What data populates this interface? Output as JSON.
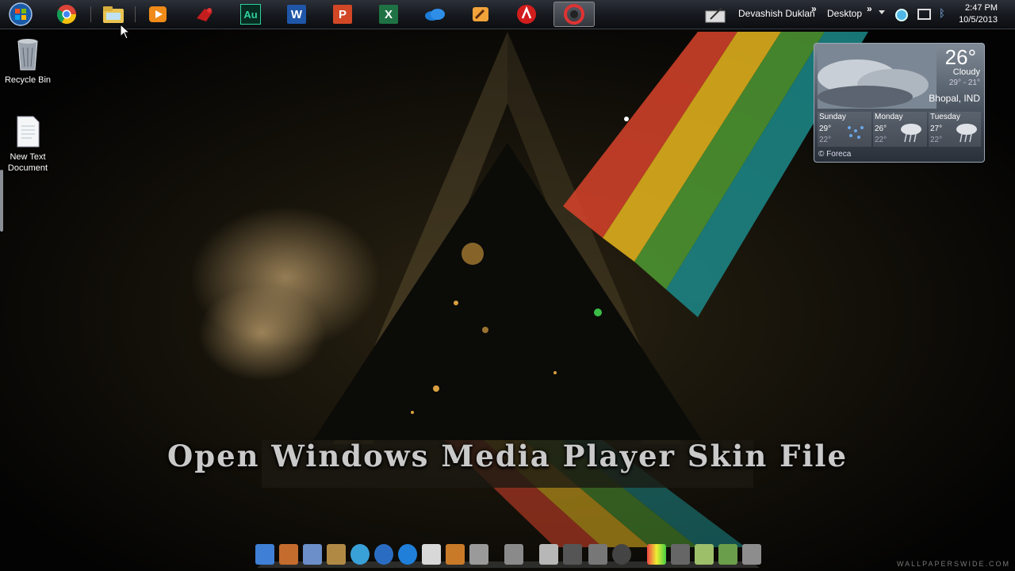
{
  "taskbar": {
    "start_button": "start-orb-icon",
    "pinned": [
      "chrome-icon",
      "windows-explorer-icon",
      "media-player-icon",
      "app-icon",
      "audition-icon",
      "word-icon",
      "powerpoint-icon",
      "excel-icon",
      "onedrive-icon",
      "app-icon-2",
      "adobe-icon",
      "media-app-icon"
    ],
    "pinned_labels": {
      "audition": "Au",
      "word": "W",
      "powerpoint": "P",
      "excel": "X"
    },
    "toolbar_user": "Devashish Duklan",
    "toolbar_chevron": "»",
    "toolbar_desktop": "Desktop",
    "tray_chevron": "»",
    "clock_time": "2:47 PM",
    "clock_date": "10/5/2013"
  },
  "desktop": {
    "icons": [
      {
        "label": "Recycle Bin",
        "icon": "recycle-bin-icon"
      },
      {
        "label": "New Text Document",
        "icon": "text-document-icon"
      }
    ]
  },
  "weather": {
    "temp": "26°",
    "condition": "Cloudy",
    "range": "29° - 21°",
    "location": "Bhopal, IND",
    "forecast": [
      {
        "day": "Sunday",
        "high": "29°",
        "low": "22°"
      },
      {
        "day": "Monday",
        "high": "26°",
        "low": "22°"
      },
      {
        "day": "Tuesday",
        "high": "27°",
        "low": "22°"
      }
    ],
    "credit": "© Foreca"
  },
  "headline": "Open Windows Media Player Skin File",
  "dock": {
    "items": [
      "finder-icon",
      "home-icon",
      "image-icon",
      "folder-icon",
      "messenger-icon",
      "media-icon",
      "ie-icon",
      "mail-icon",
      "tools-icon",
      "calculator-icon",
      "settings-icon",
      "editor-icon",
      "network-icon",
      "preferences-icon",
      "power-icon",
      "colors-icon",
      "downloads-icon",
      "controller-icon",
      "archive-icon",
      "trash-icon"
    ]
  },
  "watermark": "WALLPAPERSWIDE.COM",
  "colors": {
    "taskbar_bg": "#15181d",
    "desktop_bg": "#050505",
    "accent_red": "#d8432b",
    "accent_yellow": "#e8b71e",
    "accent_green": "#4f9a33",
    "accent_teal": "#1c8a8a"
  }
}
